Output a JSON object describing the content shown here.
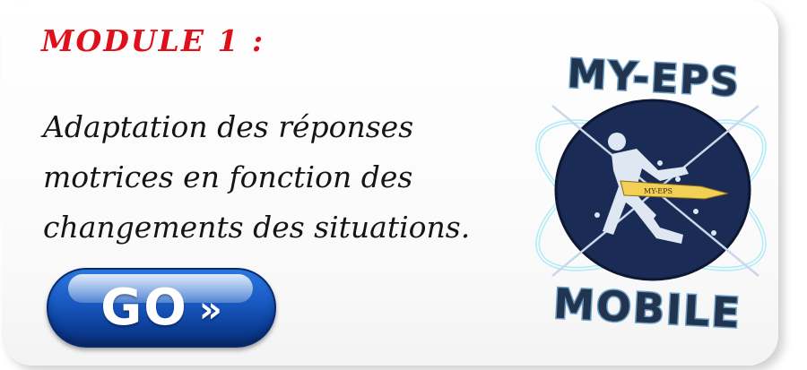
{
  "module": {
    "title": "MODULE 1 :",
    "description_lines": [
      "Adaptation des réponses",
      "motrices en fonction des",
      "changements des situations."
    ]
  },
  "go_button": {
    "label": "GO",
    "arrow": "»"
  },
  "logo": {
    "top_text": "MY-EPS",
    "bottom_text": "MOBILE",
    "banner_text": "MY-EPS",
    "icon": "athlete-silhouette-icon"
  },
  "colors": {
    "title": "#e0101a",
    "button": "#1858bf",
    "logo_circle": "#1a2b55",
    "logo_text": "#23344f",
    "logo_text_outline": "#6a9fc8"
  }
}
